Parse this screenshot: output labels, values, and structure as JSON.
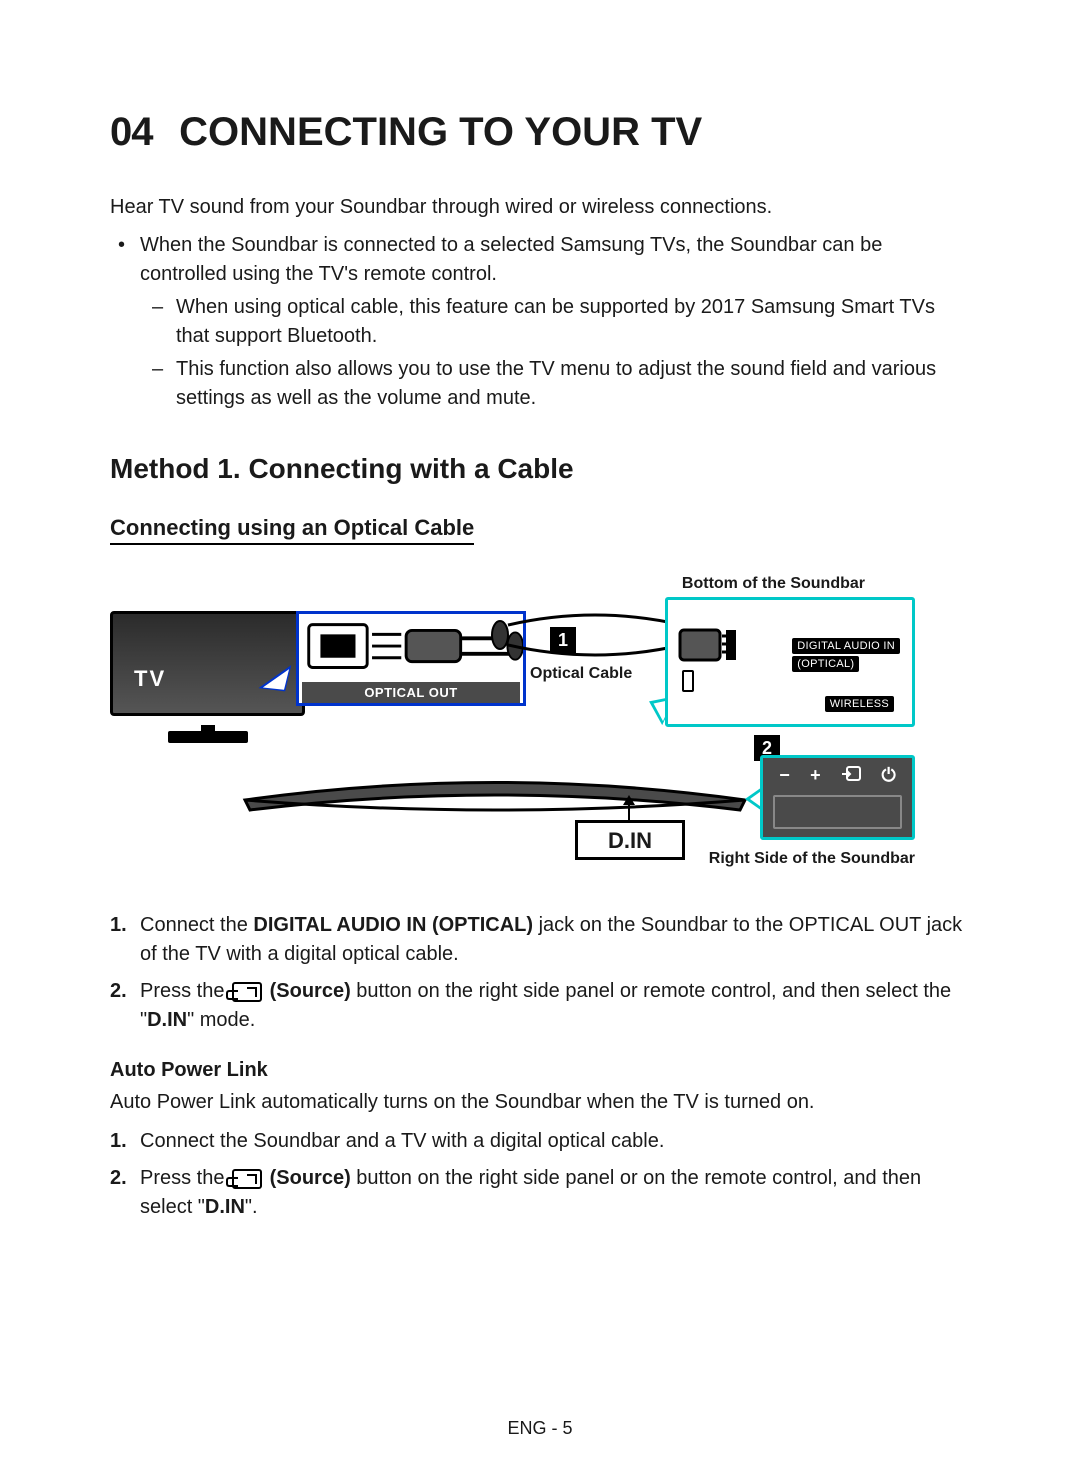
{
  "section": {
    "number": "04",
    "title": "CONNECTING TO YOUR TV"
  },
  "intro": "Hear TV sound from your Soundbar through wired or wireless connections.",
  "bullets": {
    "b1": "When the Soundbar is connected to a selected Samsung TVs, the Soundbar can be controlled using the TV's remote control.",
    "d1": "When using optical cable, this feature can be supported by 2017 Samsung Smart TVs that support Bluetooth.",
    "d2": "This function also allows you to use the TV menu to adjust the sound field and various settings as well as the volume and mute."
  },
  "method_heading": "Method 1. Connecting with a Cable",
  "sub_heading": "Connecting using an Optical Cable",
  "diagram": {
    "bottom_label": "Bottom of the Soundbar",
    "tv_label": "TV",
    "optical_out": "OPTICAL OUT",
    "cable_label": "Optical Cable",
    "digital_in_1": "DIGITAL AUDIO IN",
    "digital_in_2": "(OPTICAL)",
    "wireless": "WIRELESS",
    "marker1": "1",
    "marker2": "2",
    "din": "D.IN",
    "right_label": "Right Side of the Soundbar",
    "rs_minus": "−",
    "rs_plus": "+",
    "rs_power": "⏻"
  },
  "steps": {
    "s1_num": "1.",
    "s1a": "Connect the ",
    "s1b": "DIGITAL AUDIO IN (OPTICAL)",
    "s1c": " jack on the Soundbar to the OPTICAL OUT jack of the TV with a digital optical cable.",
    "s2_num": "2.",
    "s2a": "Press the ",
    "s2b": " (Source)",
    "s2c": " button on the right side panel or remote control, and then select the \"",
    "s2d": "D.IN",
    "s2e": "\" mode."
  },
  "apl": {
    "heading": "Auto Power Link",
    "text": "Auto Power Link automatically turns on the Soundbar when the TV is turned on.",
    "s1_num": "1.",
    "s1": "Connect the Soundbar and a TV with a digital optical cable.",
    "s2_num": "2.",
    "s2a": "Press the ",
    "s2b": " (Source)",
    "s2c": " button on the right side panel or on the remote control, and then select \"",
    "s2d": "D.IN",
    "s2e": "\"."
  },
  "page_num": "ENG - 5"
}
